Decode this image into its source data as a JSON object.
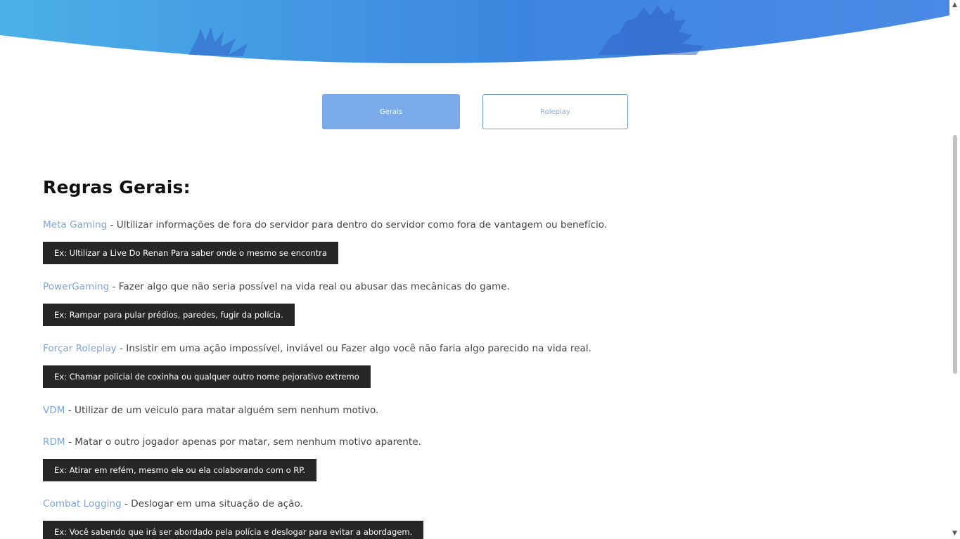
{
  "tabs": {
    "general": "Gerais",
    "roleplay": "Roleplay"
  },
  "heading": "Regras Gerais:",
  "rules": [
    {
      "term": "Meta Gaming",
      "description": " - Ultilizar informações de fora do servidor para dentro do servidor como fora de vantagem ou benefício.",
      "example": "Ex: Ultilizar a Live Do Renan Para saber onde o mesmo se encontra"
    },
    {
      "term": "PowerGaming",
      "description": " - Fazer algo que não seria possível na vida real ou abusar das mecânicas do game.",
      "example": "Ex: Rampar para pular prédios, paredes, fugir da polícia."
    },
    {
      "term": "Forçar Roleplay",
      "description": " - Insistir em uma ação impossível, inviável ou Fazer algo você não faria algo parecido na vida real.",
      "example": "Ex: Chamar policial de coxinha ou qualquer outro nome pejorativo extremo"
    },
    {
      "term": "VDM",
      "description": " - Utilizar de um veiculo para matar alguém sem nenhum motivo.",
      "example": ""
    },
    {
      "term": "RDM",
      "description": " - Matar o outro jogador apenas por matar, sem nenhum motivo aparente.",
      "example": "Ex: Atirar em refém, mesmo ele ou ela colaborando com o RP."
    },
    {
      "term": "Combat Logging",
      "description": " - Deslogar em uma situação de ação.",
      "example": "Ex: Você sabendo que irá ser abordado pela polícia e deslogar para evitar a abordagem."
    }
  ],
  "colors": {
    "accent": "#7ea4dc",
    "tab_active_bg": "#7aaae8",
    "example_bg": "#272727",
    "hero_start": "#4cb0e6",
    "hero_end": "#3f7fdf"
  }
}
